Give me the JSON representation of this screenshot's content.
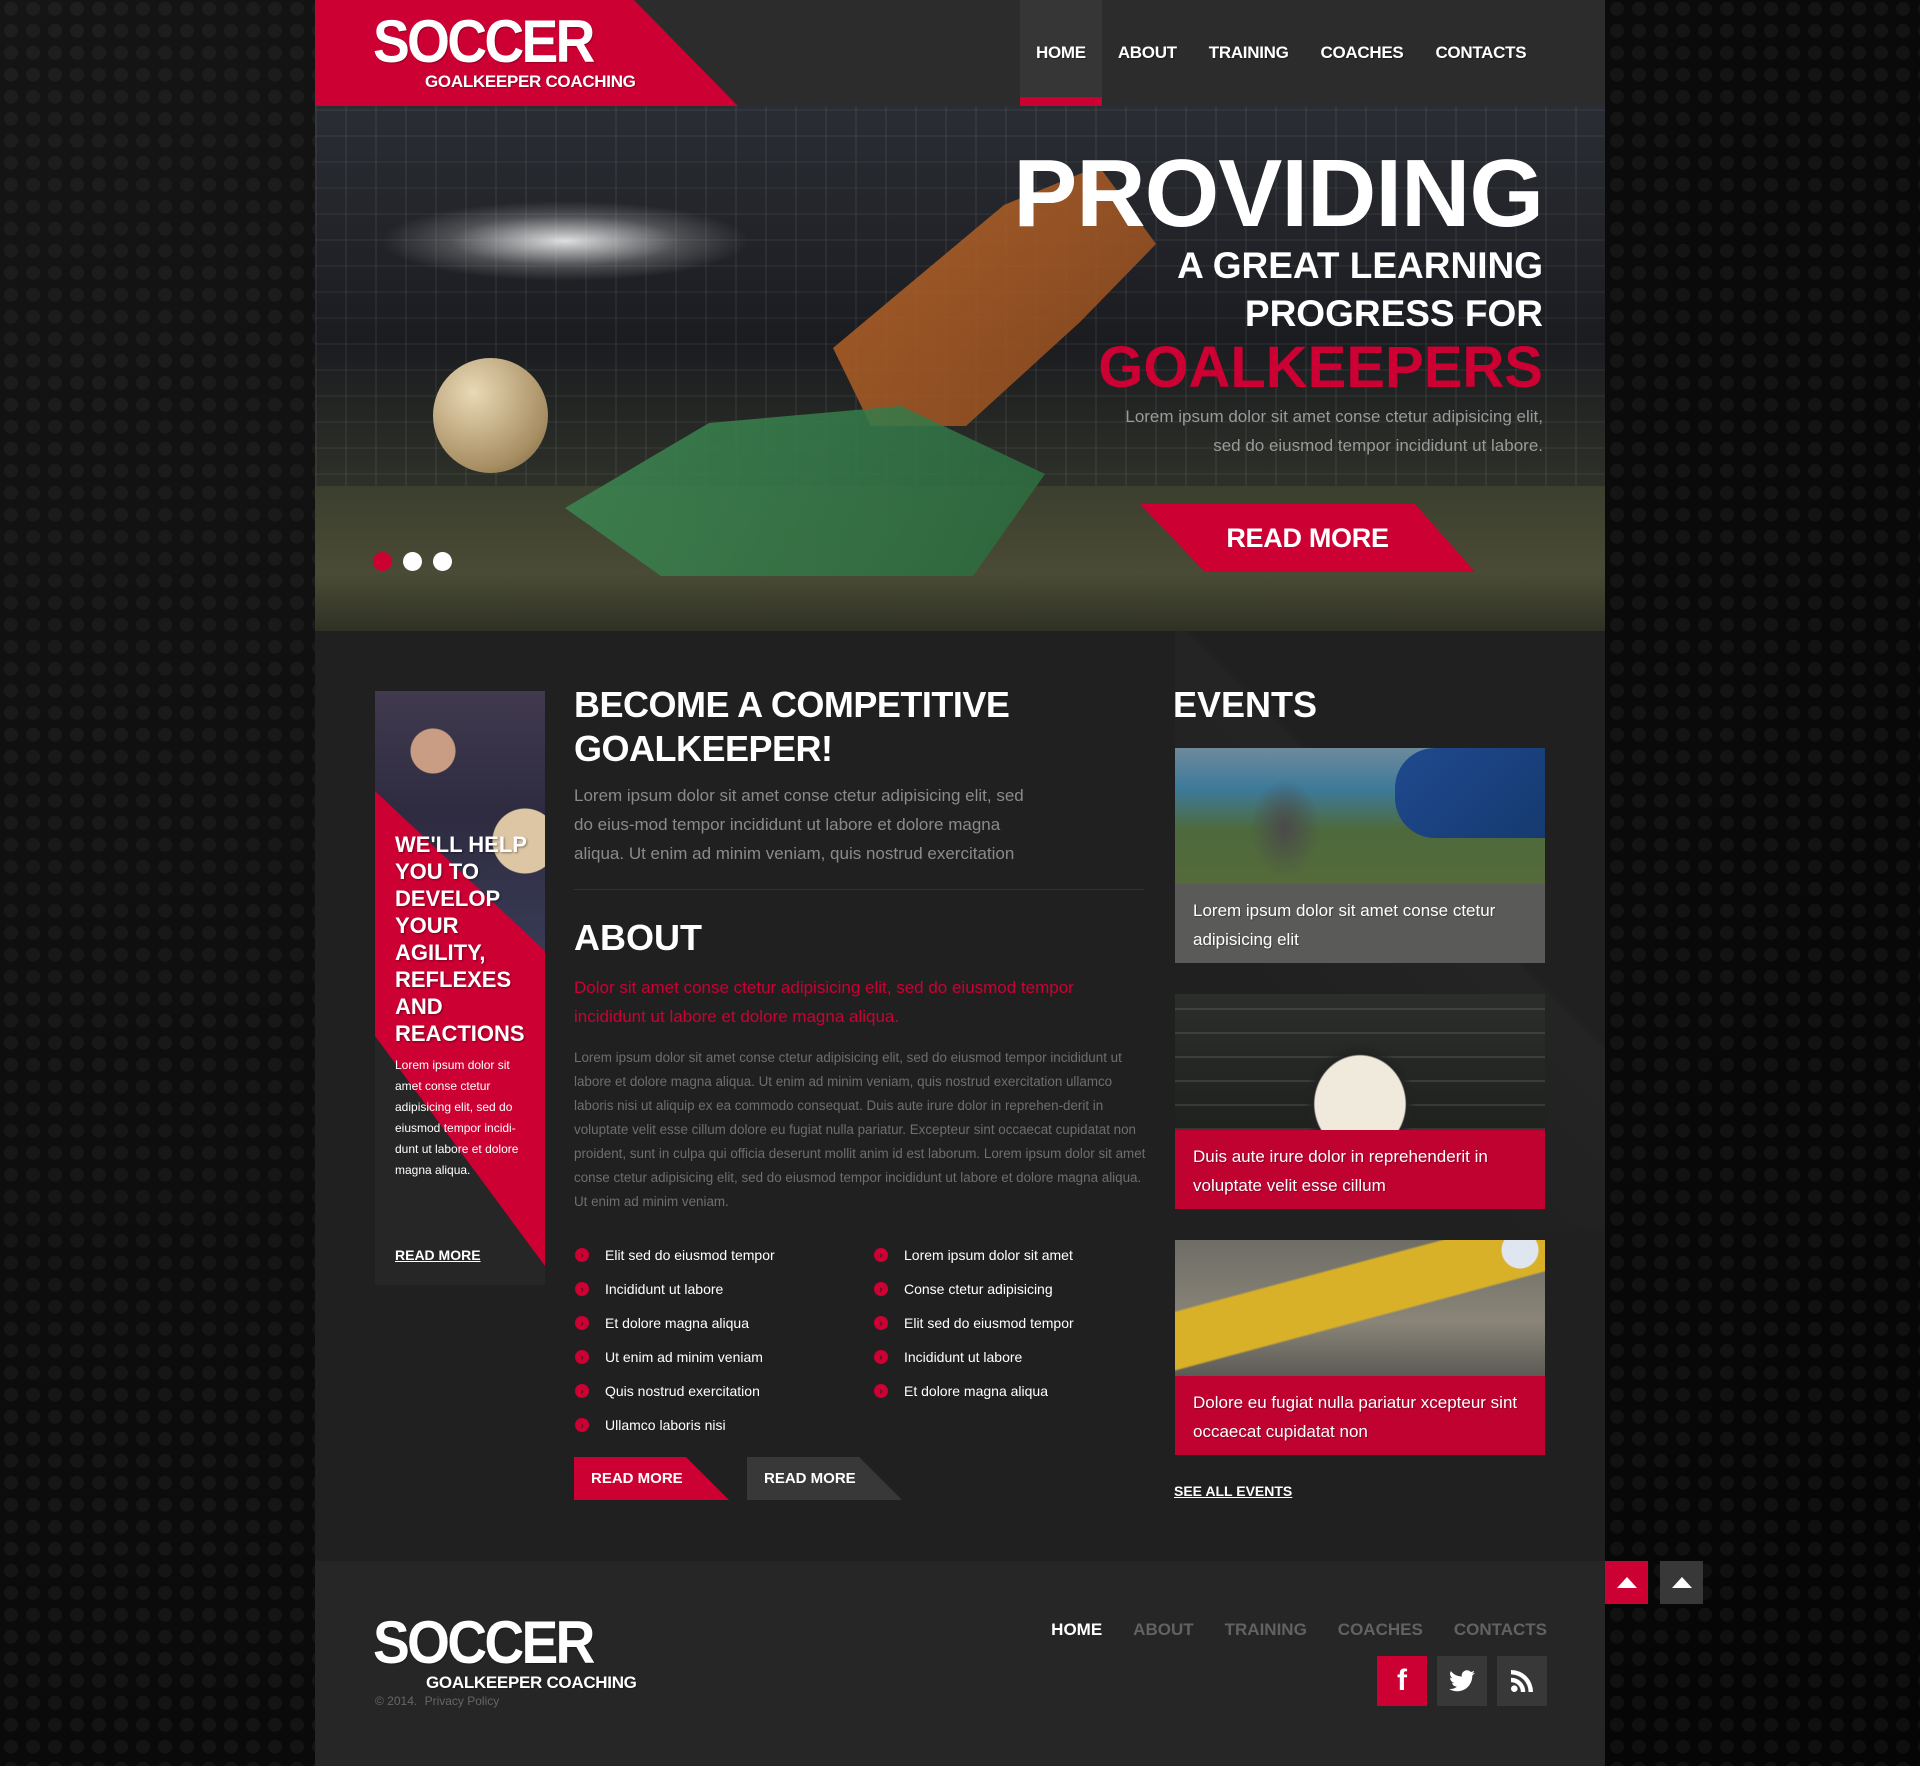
{
  "brand": {
    "name": "SOCCER",
    "tagline": "GOALKEEPER COACHING",
    "accent_color": "#cc0033"
  },
  "nav": {
    "items": [
      {
        "label": "HOME",
        "active": true
      },
      {
        "label": "ABOUT",
        "active": false
      },
      {
        "label": "TRAINING",
        "active": false
      },
      {
        "label": "COACHES",
        "active": false
      },
      {
        "label": "CONTACTS",
        "active": false
      }
    ]
  },
  "hero": {
    "line1": "PROVIDING",
    "line2": "A GREAT LEARNING",
    "line3": "PROGRESS FOR",
    "line4": "GOALKEEPERS",
    "desc_line1": "Lorem ipsum dolor sit amet conse ctetur adipisicing elit,",
    "desc_line2": "sed do eiusmod tempor incididunt ut labore.",
    "button": "READ MORE",
    "slides_total": 3,
    "slide_active": 1
  },
  "promo": {
    "title": "WE'LL HELP YOU TO DEVELOP YOUR AGILITY, REFLEXES AND REACTIONS",
    "text": "Lorem ipsum dolor sit amet conse ctetur adipisicing elit, sed do eiusmod tempor incidi-dunt ut labore et dolore magna aliqua.",
    "link": "READ MORE"
  },
  "intro": {
    "heading": "BECOME A COMPETITIVE GOALKEEPER!",
    "text": "Lorem ipsum dolor sit amet conse ctetur adipisicing elit, sed do eius-mod tempor incididunt ut labore et dolore magna aliqua. Ut enim ad minim veniam, quis nostrud exercitation"
  },
  "about": {
    "heading": "ABOUT",
    "lead": "Dolor sit amet conse ctetur adipisicing elit, sed do eiusmod tempor incididunt ut labore et dolore magna aliqua.",
    "body": "Lorem ipsum dolor sit amet conse ctetur adipisicing elit, sed do eiusmod tempor incididunt ut labore et dolore magna aliqua. Ut enim ad minim veniam, quis nostrud exercitation ullamco laboris nisi ut aliquip ex ea commodo consequat. Duis aute irure dolor in reprehen-derit in voluptate velit esse cillum dolore eu fugiat nulla pariatur. Excepteur sint occaecat cupidatat non proident, sunt in culpa qui officia deserunt mollit anim id est laborum. Lorem ipsum dolor sit amet conse ctetur adipisicing elit, sed do eiusmod tempor incididunt ut labore et dolore magna aliqua. Ut enim ad minim veniam.",
    "list_left": [
      "Elit sed do eiusmod tempor",
      "Incididunt ut labore",
      "Et dolore magna aliqua",
      "Ut enim ad minim veniam",
      "Quis nostrud exercitation",
      "Ullamco laboris nisi"
    ],
    "list_right": [
      "Lorem ipsum dolor sit amet",
      "Conse ctetur adipisicing",
      "Elit sed do eiusmod tempor",
      "Incididunt ut labore",
      "Et dolore magna aliqua"
    ],
    "button_primary": "READ MORE",
    "button_secondary": "READ MORE"
  },
  "events": {
    "heading": "EVENTS",
    "items": [
      {
        "caption": "Lorem ipsum dolor sit amet conse ctetur adipisicing elit"
      },
      {
        "caption": "Duis aute irure dolor in reprehenderit in voluptate velit esse cillum"
      },
      {
        "caption": "Dolore eu fugiat nulla pariatur xcepteur sint occaecat cupidatat non"
      }
    ],
    "see_all": "SEE ALL EVENTS"
  },
  "footer": {
    "nav": [
      {
        "label": "HOME",
        "active": true
      },
      {
        "label": "ABOUT",
        "active": false
      },
      {
        "label": "TRAINING",
        "active": false
      },
      {
        "label": "COACHES",
        "active": false
      },
      {
        "label": "CONTACTS",
        "active": false
      }
    ],
    "copyright": "© 2014.",
    "privacy": "Privacy Policy",
    "social": [
      {
        "icon": "facebook-icon",
        "glyph": "f"
      },
      {
        "icon": "twitter-icon",
        "glyph": ""
      },
      {
        "icon": "rss-icon",
        "glyph": ""
      }
    ]
  },
  "scroll_top": {
    "icon": "arrow-up-icon"
  }
}
